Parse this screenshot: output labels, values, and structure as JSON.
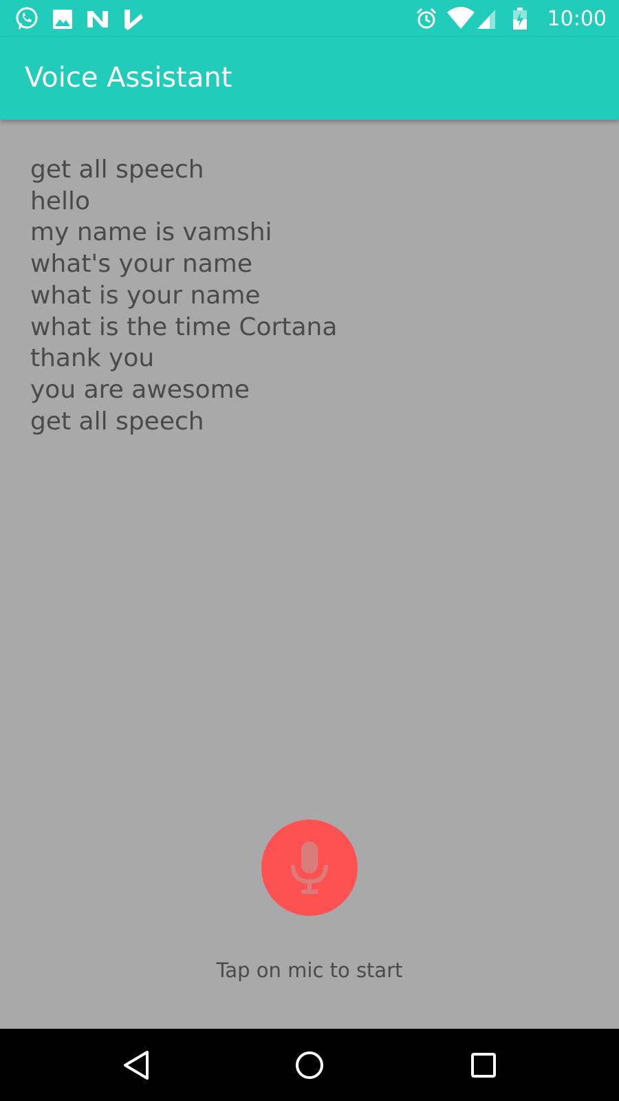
{
  "status_bar": {
    "time": "10:00",
    "left_icons": [
      "whatsapp-icon",
      "gallery-icon",
      "n-app-icon",
      "checkmark-app-icon"
    ],
    "right_icons": [
      "alarm-icon",
      "wifi-icon",
      "signal-icon",
      "battery-icon"
    ]
  },
  "app_bar": {
    "title": "Voice Assistant",
    "color": "#21ccbb"
  },
  "speech_lines": [
    "get all speech",
    "hello",
    "my name is vamshi",
    "what's your name",
    "what is your name",
    "what is the time Cortana",
    "thank you",
    "you are awesome",
    "get all speech"
  ],
  "mic": {
    "icon": "microphone-icon",
    "color": "#fe5252",
    "hint": "Tap on mic to start"
  },
  "nav_bar": {
    "buttons": [
      "back-icon",
      "home-icon",
      "recents-icon"
    ]
  }
}
